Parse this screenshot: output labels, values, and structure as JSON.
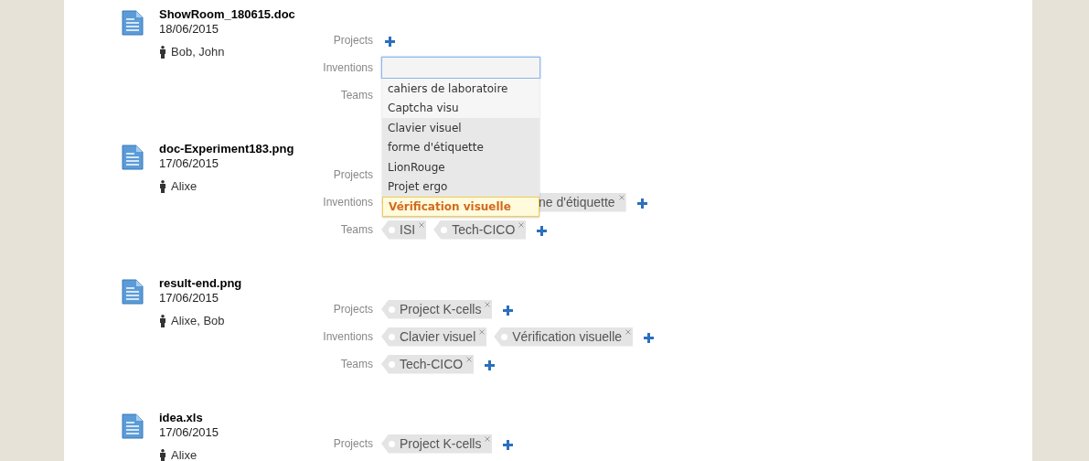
{
  "documents": [
    {
      "name": "ShowRoom_180615.doc",
      "date": "18/06/2015",
      "people": "Bob, John",
      "fields": [
        {
          "label": "Projects",
          "add": true
        },
        {
          "label": "Inventions",
          "editing": true,
          "dropdown": [
            {
              "label": "cahiers de laboratoire",
              "selected": false
            },
            {
              "label": "Captcha visu",
              "selected": false
            },
            {
              "label": "Clavier visuel",
              "selected": false
            },
            {
              "label": "forme d'étiquette",
              "selected": false
            },
            {
              "label": "LionRouge",
              "selected": false
            },
            {
              "label": "Projet ergo",
              "selected": false
            },
            {
              "label": "Vérification visuelle",
              "selected": true
            }
          ]
        },
        {
          "label": "Teams",
          "add": false
        }
      ]
    },
    {
      "name": "doc-Experiment183.png",
      "date": "17/06/2015",
      "people": "Alixe",
      "fields": [
        {
          "label": "Projects",
          "add": false
        },
        {
          "label": "Inventions",
          "add": true,
          "tags": [
            {
              "label": "ne d'étiquette",
              "covered": true
            }
          ]
        },
        {
          "label": "Teams",
          "add": true,
          "tags": [
            {
              "label": "ISI",
              "covered": false
            },
            {
              "label": "Tech-CICO",
              "covered": false
            }
          ]
        }
      ]
    },
    {
      "name": "result-end.png",
      "date": "17/06/2015",
      "people": "Alixe, Bob",
      "fields": [
        {
          "label": "Projects",
          "add": true,
          "tags": [
            {
              "label": "Project K-cells",
              "covered": false
            }
          ]
        },
        {
          "label": "Inventions",
          "add": true,
          "tags": [
            {
              "label": "Clavier visuel",
              "covered": false
            },
            {
              "label": "Vérification visuelle",
              "covered": false
            }
          ]
        },
        {
          "label": "Teams",
          "add": true,
          "tags": [
            {
              "label": "Tech-CICO",
              "covered": false
            }
          ]
        }
      ]
    },
    {
      "name": "idea.xls",
      "date": "17/06/2015",
      "people": "Alixe",
      "fields": [
        {
          "label": "Projects",
          "add": true,
          "tags": [
            {
              "label": "Project K-cells",
              "covered": false
            }
          ]
        }
      ]
    }
  ]
}
